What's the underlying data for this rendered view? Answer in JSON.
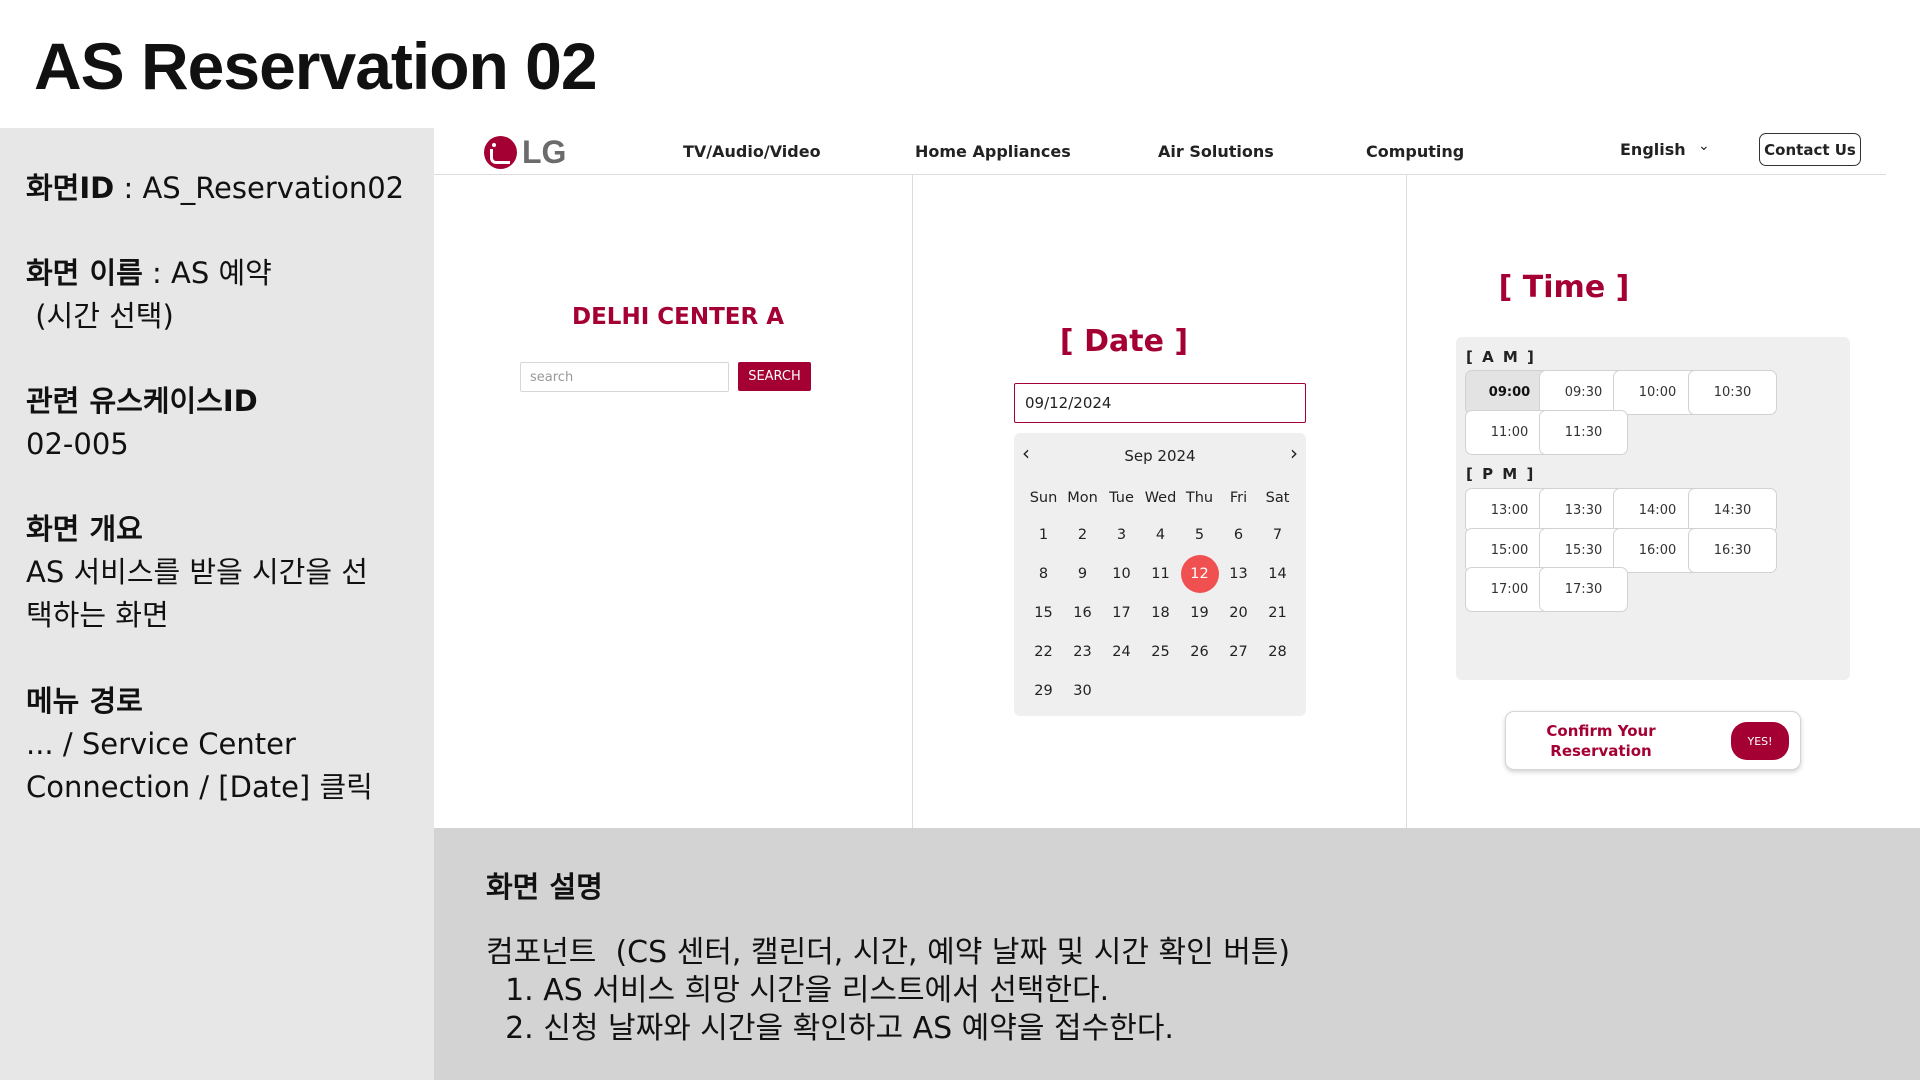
{
  "slide": {
    "title": "AS Reservation 02"
  },
  "info": {
    "screen_id_label": "화면ID",
    "screen_id_value": " : AS_Reservation02",
    "screen_name_label": "화면 이름",
    "screen_name_value": " : AS 예약",
    "screen_name_value2": " (시간 선택)",
    "usecase_label": "관련 유스케이스ID",
    "usecase_value": "02-005",
    "overview_label": "화면 개요",
    "overview_line1": "AS 서비스를 받을 시간을 선",
    "overview_line2": "택하는 화면",
    "menu_label": "메뉴 경로",
    "menu_line1": "... / Service Center",
    "menu_line2": "Connection / [Date] 클릭"
  },
  "description": {
    "title": "화면 설명",
    "lines": [
      "컴포넌트  (CS 센터, 캘린더, 시간, 예약 날짜 및 시간 확인 버튼)",
      "  1. AS 서비스 희망 시간을 리스트에서 선택한다.",
      "  2. 신청 날짜와 시간을 확인하고 AS 예약을 접수한다."
    ]
  },
  "nav": {
    "logo_text": "LG",
    "items": [
      "TV/Audio/Video",
      "Home Appliances",
      "Air Solutions",
      "Computing"
    ],
    "language": "English",
    "contact": "Contact Us"
  },
  "center": {
    "name": "DELHI CENTER A",
    "search_placeholder": "search",
    "search_button": "SEARCH"
  },
  "date": {
    "title": "[ Date ]",
    "value": "09/12/2024",
    "month_label": "Sep 2024",
    "weekdays": [
      "Sun",
      "Mon",
      "Tue",
      "Wed",
      "Thu",
      "Fri",
      "Sat"
    ],
    "days": [
      [
        "1",
        "2",
        "3",
        "4",
        "5",
        "6",
        "7"
      ],
      [
        "8",
        "9",
        "10",
        "11",
        "12",
        "13",
        "14"
      ],
      [
        "15",
        "16",
        "17",
        "18",
        "19",
        "20",
        "21"
      ],
      [
        "22",
        "23",
        "24",
        "25",
        "26",
        "27",
        "28"
      ],
      [
        "29",
        "30",
        "",
        "",
        "",
        "",
        ""
      ]
    ],
    "selected_day": "12"
  },
  "time": {
    "title": "[ Time ]",
    "am_label": "[ A M ]",
    "pm_label": "[ P M ]",
    "am_slots": [
      "09:00",
      "09:30",
      "10:00",
      "10:30",
      "11:00",
      "11:30"
    ],
    "pm_slots": [
      "13:00",
      "13:30",
      "14:00",
      "14:30",
      "15:00",
      "15:30",
      "16:00",
      "16:30",
      "17:00",
      "17:30"
    ],
    "selected": "09:00"
  },
  "confirm": {
    "text_line1": "Confirm Your",
    "text_line2": "Reservation",
    "yes_button": "YES!"
  },
  "colors": {
    "brand": "#a50034",
    "selected_day": "#f05050",
    "left_panel": "#e7e7e7",
    "bottom_panel": "#d3d3d3"
  }
}
